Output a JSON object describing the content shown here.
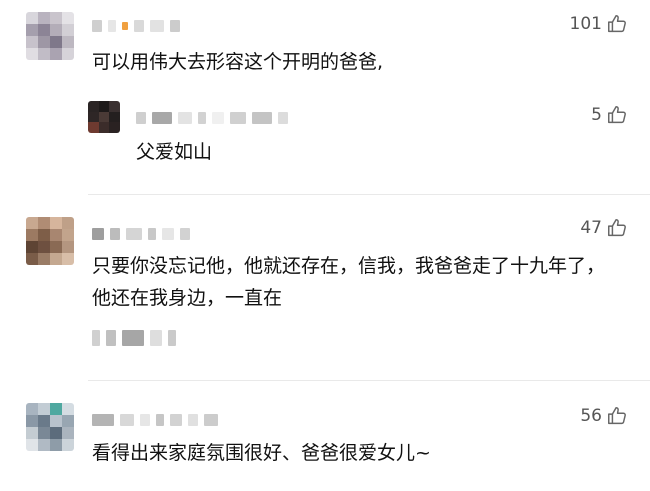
{
  "comments": [
    {
      "likes": "101",
      "text": "可以用伟大去形容这个开明的爸爸,",
      "reply": {
        "likes": "5",
        "text": "父爱如山"
      }
    },
    {
      "likes": "47",
      "text": "只要你没忘记他，他就还存在，信我，我爸爸走了十九年了，他还在我身边，一直在"
    },
    {
      "likes": "56",
      "text": "看得出来家庭氛围很好、爸爸很爱女儿~"
    }
  ],
  "icons": {
    "like": "thumbs-up-icon"
  },
  "colors": {
    "text": "#111111",
    "meta": "#555555",
    "divider": "#e9e9e9"
  }
}
